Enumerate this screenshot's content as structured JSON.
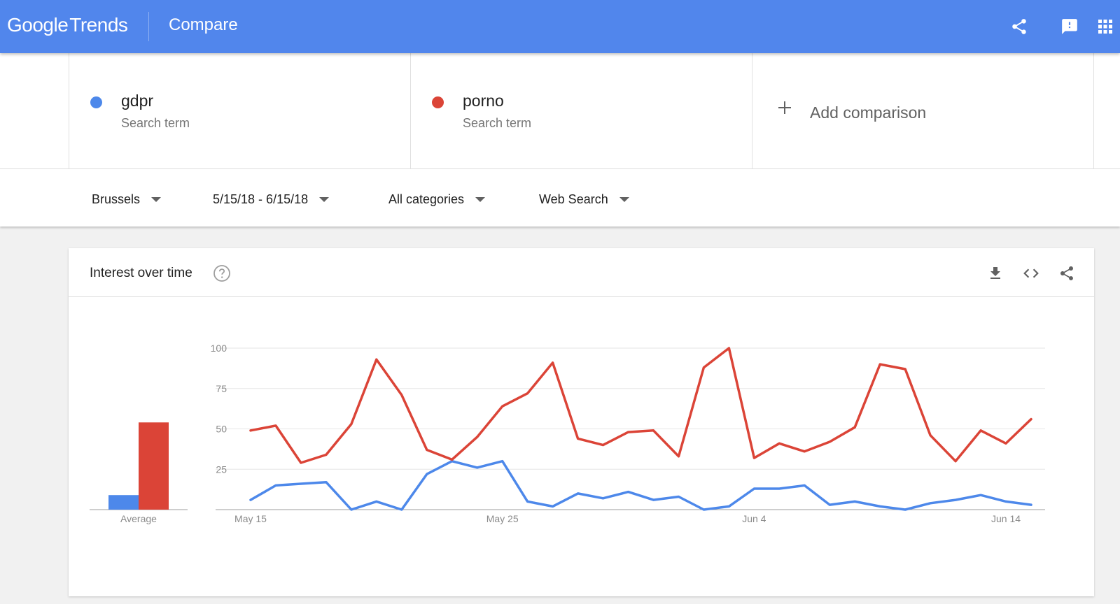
{
  "header": {
    "logo_google": "Google",
    "logo_trends": "Trends",
    "title": "Compare",
    "icons": [
      "share-icon",
      "feedback-icon",
      "apps-icon"
    ],
    "bg_color": "#5186ec"
  },
  "terms": [
    {
      "name": "gdpr",
      "sub": "Search term",
      "color": "#4d88ea"
    },
    {
      "name": "porno",
      "sub": "Search term",
      "color": "#db4437"
    }
  ],
  "add_comparison": {
    "label": "Add comparison"
  },
  "filters": {
    "location": "Brussels",
    "date_range": "5/15/18 - 6/15/18",
    "category": "All categories",
    "search_type": "Web Search"
  },
  "card": {
    "title": "Interest over time",
    "icons": [
      "help-icon",
      "download-icon",
      "embed-icon",
      "share-icon"
    ]
  },
  "chart_data": {
    "type": "line",
    "ylim": [
      0,
      100
    ],
    "y_ticks": [
      "100",
      "75",
      "50",
      "25"
    ],
    "x_ticks": [
      "May 15",
      "May 25",
      "Jun 4",
      "Jun 14"
    ],
    "x": [
      "May 15",
      "May 16",
      "May 17",
      "May 18",
      "May 19",
      "May 20",
      "May 21",
      "May 22",
      "May 23",
      "May 24",
      "May 25",
      "May 26",
      "May 27",
      "May 28",
      "May 29",
      "May 30",
      "May 31",
      "Jun 1",
      "Jun 2",
      "Jun 3",
      "Jun 4",
      "Jun 5",
      "Jun 6",
      "Jun 7",
      "Jun 8",
      "Jun 9",
      "Jun 10",
      "Jun 11",
      "Jun 12",
      "Jun 13",
      "Jun 14",
      "Jun 15"
    ],
    "series": [
      {
        "name": "gdpr",
        "color": "#4d88ea",
        "values": [
          6,
          15,
          16,
          17,
          0,
          5,
          0,
          22,
          30,
          26,
          30,
          5,
          2,
          10,
          7,
          11,
          6,
          8,
          0,
          2,
          13,
          13,
          15,
          3,
          5,
          2,
          0,
          4,
          6,
          9,
          5,
          3
        ]
      },
      {
        "name": "porno",
        "color": "#db4437",
        "values": [
          49,
          52,
          29,
          34,
          53,
          93,
          71,
          37,
          31,
          45,
          64,
          72,
          91,
          44,
          40,
          48,
          49,
          33,
          88,
          100,
          32,
          41,
          36,
          42,
          51,
          90,
          87,
          46,
          30,
          49,
          41,
          56
        ]
      }
    ],
    "average": {
      "label": "Average",
      "values": [
        {
          "name": "gdpr",
          "value": 9,
          "color": "#4d88ea"
        },
        {
          "name": "porno",
          "value": 54,
          "color": "#db4437"
        }
      ]
    }
  }
}
